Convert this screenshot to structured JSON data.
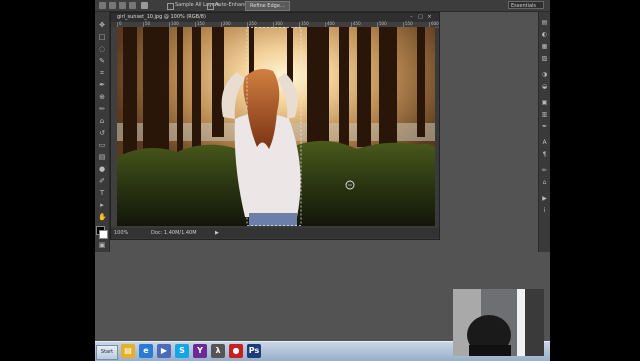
{
  "options_bar": {
    "sample_all_layers_label": "Sample All Layers",
    "auto_enhance_label": "Auto-Enhance",
    "refine_edge_label": "Refine Edge...",
    "workspace_label": "Essentials"
  },
  "document": {
    "title": "girl_sunset_10.jpg @ 100% (RGB/8)",
    "zoom": "100%",
    "doc_size": "Doc: 1.40M/1.40M",
    "status_arrow": "▶"
  },
  "ruler_labels": [
    "0",
    "50",
    "100",
    "150",
    "200",
    "250",
    "300",
    "350",
    "400",
    "450",
    "500",
    "550",
    "600"
  ],
  "window_controls": [
    "–",
    "□",
    "×"
  ],
  "taskbar": {
    "start_label": "Start",
    "icons": [
      {
        "name": "explorer",
        "glyph": "▤",
        "color": "#e3b12b"
      },
      {
        "name": "ie",
        "glyph": "e",
        "color": "#2a7bd3"
      },
      {
        "name": "media",
        "glyph": "▶",
        "color": "#4b6bb8"
      },
      {
        "name": "skype",
        "glyph": "S",
        "color": "#12a5e8"
      },
      {
        "name": "yahoo",
        "glyph": "Y",
        "color": "#6c2a95"
      },
      {
        "name": "half-life",
        "glyph": "λ",
        "color": "#555555"
      },
      {
        "name": "record",
        "glyph": "●",
        "color": "#c62020"
      },
      {
        "name": "photoshop",
        "glyph": "Ps",
        "color": "#1b3d7a"
      }
    ]
  },
  "colors": {
    "app_bg": "#535353",
    "panel": "#3a3a3a",
    "foreground_swatch": "#000000",
    "background_swatch": "#ffffff"
  }
}
